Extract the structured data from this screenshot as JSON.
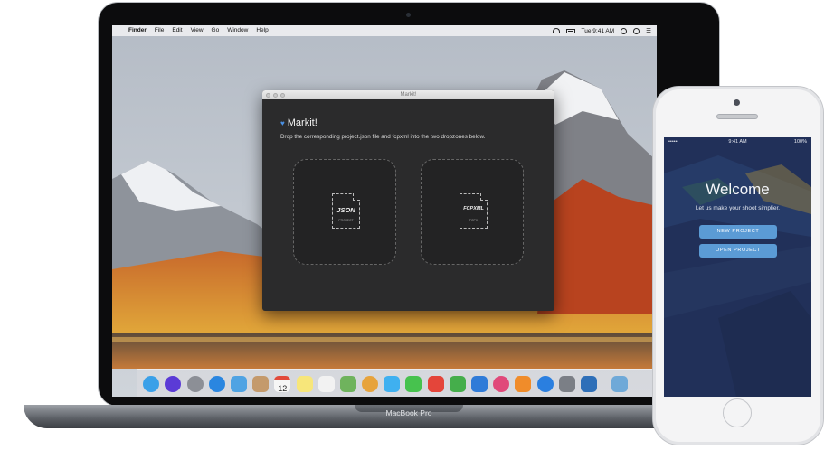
{
  "menubar": {
    "apple": "",
    "app": "Finder",
    "items": [
      "File",
      "Edit",
      "View",
      "Go",
      "Window",
      "Help"
    ],
    "time": "Tue 9:41 AM"
  },
  "window": {
    "title": "Markit!",
    "heading": "Markit!",
    "description": "Drop the corresponding project.json file and fcpxml into the two dropzones below.",
    "dropzones": [
      {
        "label": "JSON",
        "sub": "PROJECT"
      },
      {
        "label": "FCPXML",
        "sub": "FCPX"
      }
    ]
  },
  "dock": {
    "icons": [
      "finder-icon",
      "siri-icon",
      "launchpad-icon",
      "safari-icon",
      "mail-icon",
      "contacts-icon",
      "calendar-icon",
      "notes-icon",
      "reminders-icon",
      "maps-icon",
      "photos-icon",
      "messages-icon",
      "facetime-icon",
      "news-icon",
      "numbers-icon",
      "keynote-icon",
      "itunes-icon",
      "ibooks-icon",
      "app-store-icon",
      "preferences-icon",
      "markit-icon",
      "folder-icon"
    ],
    "colors": [
      "#3aa0e8",
      "#5b3bd6",
      "#8c8f96",
      "#2a86e0",
      "#4fa3e3",
      "#c49a6c",
      "#f6f6f6",
      "#f7e67a",
      "#f2f2f2",
      "#6fb35d",
      "#e7a33c",
      "#3fb0f0",
      "#47c24e",
      "#e4453a",
      "#45ae4b",
      "#2f7bd8",
      "#e0497a",
      "#f08c2a",
      "#2a7fe0",
      "#7b7f86",
      "#2e6fb8",
      "#6fa9d8"
    ],
    "calendar_day": "12"
  },
  "macbook": {
    "label": "MacBook Pro"
  },
  "phone": {
    "status_left": "•••••",
    "status_time": "9:41 AM",
    "status_right": "100%",
    "welcome": "Welcome",
    "subtitle": "Let us make your shoot simplier.",
    "new_project": "NEW PROJECT",
    "open_project": "OPEN PROJECT"
  },
  "colors": {
    "accent": "#5b9bd5",
    "window_bg": "#2b2b2c"
  }
}
